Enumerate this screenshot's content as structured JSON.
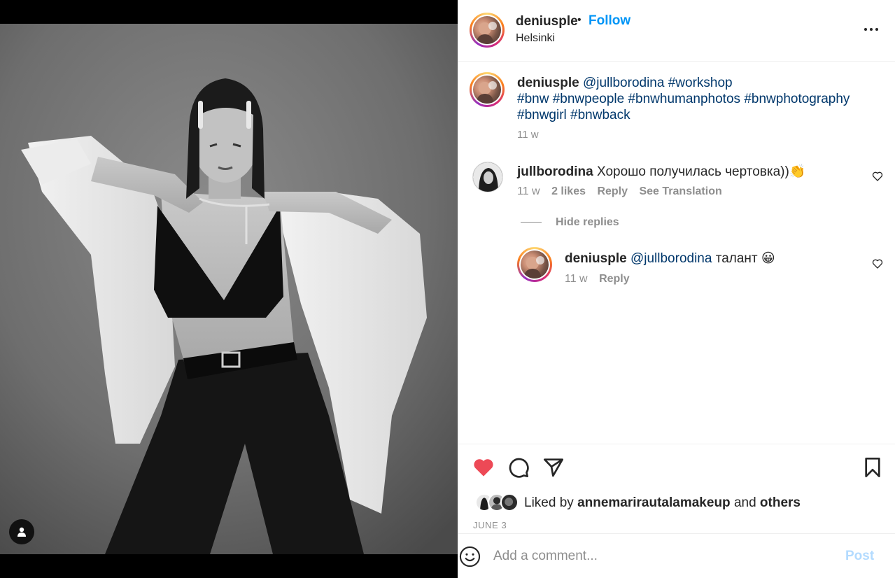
{
  "post": {
    "username": "deniusple",
    "follow_label": "Follow",
    "location": "Helsinki",
    "more_icon": "more-horizontal-icon"
  },
  "caption": {
    "username": "deniusple",
    "mention": "@jullborodina",
    "hashtag_workshop": "#workshop",
    "hashtags_line2": [
      "#bnw",
      "#bnwpeople",
      "#bnwhumanphotos",
      "#bnwphotography"
    ],
    "hashtags_line3": [
      "#bnwgirl",
      "#bnwback"
    ],
    "time": "11 w"
  },
  "comment": {
    "username": "jullborodina",
    "text": "Хорошо получилась чертовка))👏",
    "time": "11 w",
    "likes": "2 likes",
    "reply_label": "Reply",
    "translate_label": "See Translation",
    "hide_replies_label": "Hide replies"
  },
  "reply": {
    "username": "deniusple",
    "mention": "@jullborodina",
    "text": "талант 😀",
    "time": "11 w",
    "reply_label": "Reply"
  },
  "actions": {
    "liked_by_prefix": "Liked by",
    "liked_by_user": "annemarirautalamakeup",
    "liked_and": "and",
    "liked_others": "others",
    "date": "JUNE 3",
    "like_color": "#ed4956"
  },
  "comment_box": {
    "placeholder": "Add a comment...",
    "post_label": "Post"
  },
  "colors": {
    "accent": "#0095f6",
    "link": "#00376b",
    "secondary_text": "#8e8e8e"
  }
}
